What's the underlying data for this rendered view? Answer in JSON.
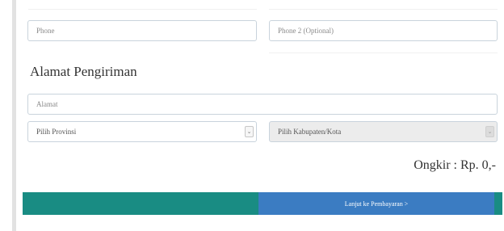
{
  "form": {
    "phone_placeholder": "Phone",
    "phone2_placeholder": "Phone 2 (Optional)"
  },
  "shipping": {
    "title": "Alamat Pengiriman",
    "address_placeholder": "Alamat",
    "province_value": "Pilih Provinsi",
    "city_value": "Pilih Kabupaten/Kota",
    "dropdown_icon": "chevron-down-icon"
  },
  "summary": {
    "shipping_cost": "Ongkir : Rp. 0,-"
  },
  "actions": {
    "continue_label": "Lanjut ke Pembayaran >"
  },
  "colors": {
    "accent_teal": "#198c83",
    "button_blue": "#3b7cc2"
  }
}
